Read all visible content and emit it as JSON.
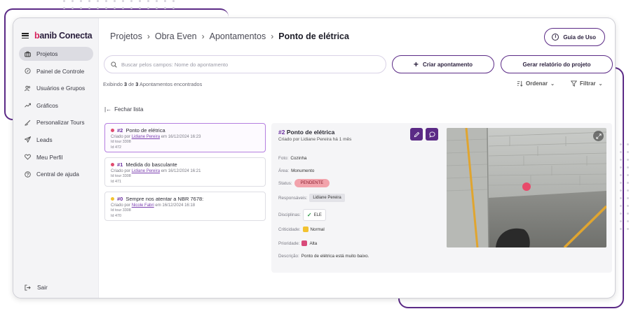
{
  "brand": {
    "logo_prefix": "b",
    "logo_rest": "anib Conecta"
  },
  "sidebar": {
    "items": [
      {
        "label": "Projetos",
        "icon": "briefcase-icon",
        "active": true
      },
      {
        "label": "Painel de Controle",
        "icon": "compass-icon",
        "active": false
      },
      {
        "label": "Usuários e Grupos",
        "icon": "users-icon",
        "active": false
      },
      {
        "label": "Gráficos",
        "icon": "trend-icon",
        "active": false
      },
      {
        "label": "Personalizar Tours",
        "icon": "brush-icon",
        "active": false
      },
      {
        "label": "Leads",
        "icon": "paper-plane-icon",
        "active": false
      },
      {
        "label": "Meu Perfil",
        "icon": "heart-icon",
        "active": false
      },
      {
        "label": "Central de ajuda",
        "icon": "help-icon",
        "active": false
      }
    ],
    "logout": "Sair"
  },
  "header": {
    "breadcrumb": [
      "Projetos",
      "Obra Even",
      "Apontamentos"
    ],
    "current": "Ponto de elétrica",
    "guide_button": "Guia de Uso"
  },
  "toolbar": {
    "search_placeholder": "Buscar pelos campos: Nome do apontamento",
    "create_button": "Criar apontamento",
    "report_button": "Gerar relatório do projeto",
    "count": {
      "prefix": "Exibindo",
      "shown": "3",
      "mid": "de",
      "total": "3",
      "suffix": "Apontamentos encontrados"
    },
    "sort_label": "Ordenar",
    "filter_label": "Filtrar"
  },
  "close_list": "Fechar lista",
  "points": [
    {
      "num": "#2",
      "title": "Ponto de elétrica",
      "dot_color": "#e04a6e",
      "created_prefix": "Criado por",
      "author": "Lidiane Pereira",
      "created_suffix": "em 16/12/2024 16:23",
      "tour": "Id tour 3308",
      "id": "Id 472",
      "selected": true
    },
    {
      "num": "#1",
      "title": "Medida do basculante",
      "dot_color": "#e04a6e",
      "created_prefix": "Criado por",
      "author": "Lidiane Pereira",
      "created_suffix": "em 16/12/2024 16:21",
      "tour": "Id tour 3308",
      "id": "Id 471",
      "selected": false
    },
    {
      "num": "#0",
      "title": "Sempre nos atentar a NBR 7678:",
      "dot_color": "#f2c230",
      "created_prefix": "Criado por",
      "author": "Nicole Fabri",
      "created_suffix": "em 16/12/2024 16:18",
      "tour": "Id tour 3308",
      "id": "Id 470",
      "selected": false
    }
  ],
  "detail": {
    "num": "#2",
    "title": "Ponto de elétrica",
    "subtitle": "Criado por Lidiane Pereira há 1 mês",
    "foto_label": "Foto:",
    "foto_value": "Cozinha",
    "area_label": "Área:",
    "area_value": "Monumento",
    "status_label": "Status:",
    "status_value": "PENDENTE",
    "responsaveis_label": "Responsáveis:",
    "responsaveis_value": "Lidiane Pereira",
    "disciplinas_label": "Disciplinas:",
    "disciplinas_value": "ELE",
    "criticidade_label": "Criticidade:",
    "criticidade_value": "Normal",
    "prioridade_label": "Prioridade:",
    "prioridade_value": "Alta",
    "descricao_label": "Descrição:",
    "descricao_value": "Ponto de elétrica está muito baixo."
  },
  "colors": {
    "accent": "#5b2a86",
    "pending": "#f2a3ac",
    "marker": "#e84a6a"
  }
}
